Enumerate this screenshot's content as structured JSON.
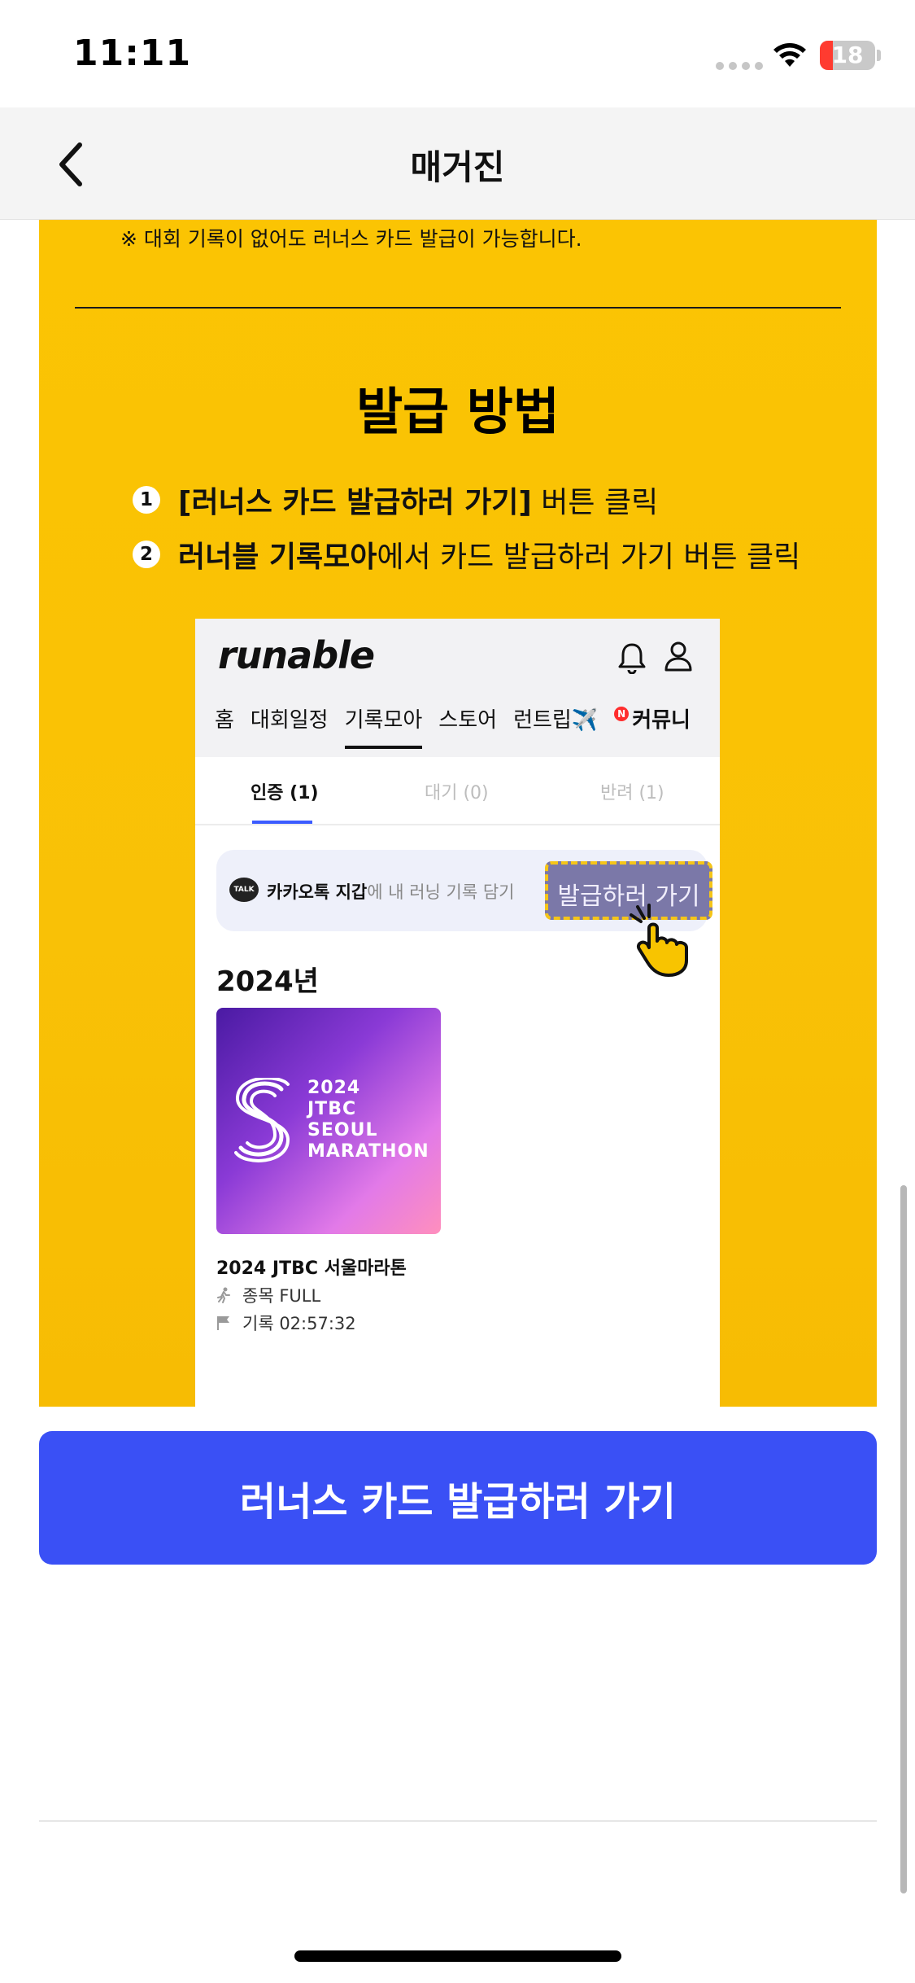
{
  "status_bar": {
    "time": "11:11",
    "battery_level": "18",
    "icons": [
      "signal-dots-icon",
      "wifi-icon",
      "battery-icon"
    ]
  },
  "nav": {
    "title": "매거진",
    "back_icon": "chevron-left-icon"
  },
  "magazine": {
    "note": "※ 대회 기록이 없어도 러너스 카드 발급이 가능합니다.",
    "section_title": "발급 방법",
    "steps": [
      {
        "num": "1",
        "bold": "[러너스 카드 발급하러 가기]",
        "rest": " 버튼 클릭"
      },
      {
        "num": "2",
        "bold": "러너블 기록모아",
        "rest": "에서 카드 발급하러 가기 버튼 클릭"
      }
    ]
  },
  "preview": {
    "logo": "runable",
    "menu": [
      "홈",
      "대회일정",
      "기록모아",
      "스토어",
      "런트립✈️",
      "커뮤니"
    ],
    "new_badge": "N",
    "tabs": [
      "인증 (1)",
      "대기 (0)",
      "반려 (1)"
    ],
    "kakao": {
      "talk_badge": "TALK",
      "bold": "카카오톡 지갑",
      "rest": "에 내 러닝 기록 담기",
      "button": "발급하러 가기"
    },
    "year": "2024년",
    "card_lines": [
      "2024",
      "JTBC",
      "SEOUL",
      "MARATHON"
    ],
    "race_name": "2024 JTBC 서울마라톤",
    "event": "종목 FULL",
    "record": "기록 02:57:32"
  },
  "cta": {
    "label": "러너스 카드 발급하러 가기"
  },
  "colors": {
    "accent_blue": "#3a50f5",
    "magazine_yellow": "#fbc403"
  }
}
